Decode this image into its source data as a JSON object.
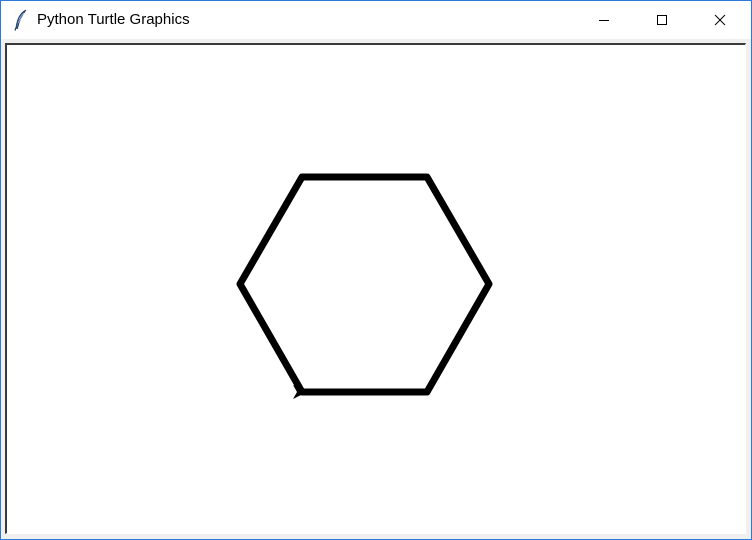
{
  "window": {
    "title": "Python Turtle Graphics",
    "icon": "feather-icon"
  },
  "controls": {
    "minimize_icon": "minimize-icon",
    "maximize_icon": "maximize-icon",
    "close_icon": "close-icon"
  },
  "canvas": {
    "background": "#ffffff",
    "drawing": {
      "shape": "hexagon",
      "pen_color": "#000000",
      "turtle_shape": "classic-arrow",
      "turtle_heading": "east"
    }
  }
}
